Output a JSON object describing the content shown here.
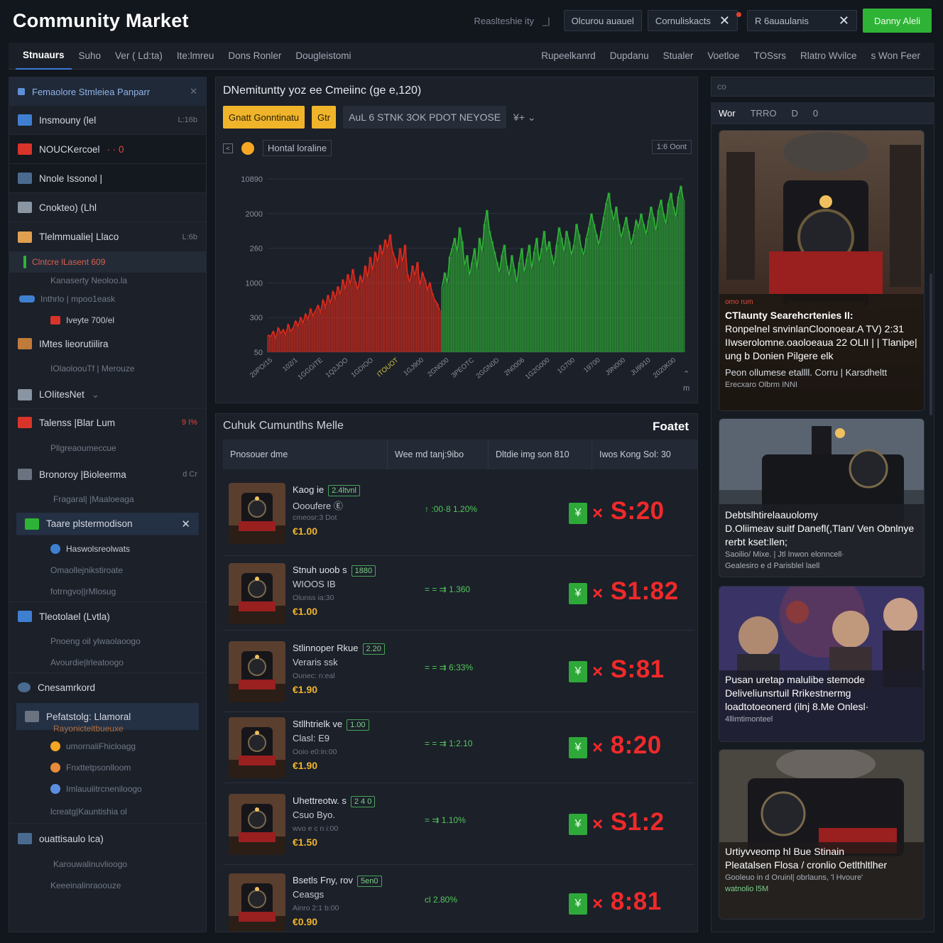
{
  "app": {
    "title": "Community Market"
  },
  "top": {
    "search_hint": "Reaslteshie ity",
    "chip1": "Olcurou auauel",
    "chip2": "Cornuliskacts",
    "chip3": "R 6auaulanis",
    "close_icon": "close-icon",
    "button": "Danny Aleli"
  },
  "nav": {
    "left": [
      "Stnuaurs",
      "Suho",
      "Ver ( Ld:ta)",
      "Ite:lmreu",
      "Dons Ronler",
      "Dougleistomi"
    ],
    "right": [
      "Rupeelkanrd",
      "Dupdanu",
      "Stualer",
      "Voetloe",
      "TOSsrs",
      "Rlatro Wvilce",
      "s Won Feer"
    ]
  },
  "sidebar": {
    "header": "Femaolore Stmleiea  Panparr",
    "items": [
      {
        "label": "Insmouny (lel",
        "meta": "L:16b",
        "style": "normal",
        "color": "#3f7fd0"
      },
      {
        "label": "NOUCKercoel",
        "meta": "· · 0",
        "style": "dark",
        "color": "#d9342a"
      },
      {
        "label": "Nnole Issonol |",
        "meta": "",
        "style": "dark",
        "color": "#4a6b8f"
      },
      {
        "label": "Cnokteo) (Lhl",
        "meta": "",
        "style": "normal",
        "color": "#8a95a3"
      },
      {
        "label": "Tlelmmualie| Llaco",
        "meta": "L:6b",
        "style": "normal",
        "color": "#e0a050"
      }
    ],
    "sub_hl": "Clntcre lLasent 609",
    "sub_a": "Kanaserty Neoloo.la",
    "sub_b": "Inthrlo | mpoo1eask",
    "sub_c": "Iveyte 700/el",
    "group2": [
      {
        "label": "IMtes lieorutiilira",
        "meta": "",
        "color": "#c07a3a",
        "sub": "IOlaoloouTf | Merouze"
      },
      {
        "label": "LOIitesNet",
        "meta": "",
        "color": "#8a95a3",
        "sub": ""
      },
      {
        "label": "Talenss  |Blar Lum",
        "meta": "9 I%",
        "color": "#d9342a",
        "sub": "Pllgreaoumeccue"
      },
      {
        "label": "Bronoroy |Bioleerma",
        "meta": "d Cr",
        "color": "#6b7380",
        "sub": "Fragaral| |Maaloeaga"
      }
    ],
    "selected": "Taare plstermodison",
    "selected_subs": [
      "Haswolsreolwats",
      "Omaollejnikstiroate",
      "fotrngvo||rMlosug"
    ],
    "group3": [
      {
        "label": "Tleotolael  (Lvtla)",
        "sub": "Pnoeng oil ylwaolaoogo",
        "sub2": "Avourdie|lrleatoogo",
        "color": "#3f7fd0"
      },
      {
        "label": "Cnesamrkord",
        "sub": "",
        "sub2": "",
        "color": "#4a6b8f"
      }
    ],
    "selected2": "Pefatstolg: Llamoral",
    "selected2_sub": "Rayonicteitbueuxe",
    "selected2_subs": [
      "umornaliFhicloagg",
      "Fnxttetpsonlloom",
      "Imlauuiitrcneniloogo",
      "lcreatg|Kauntishia ol"
    ],
    "last": "ouattisaulo lca)",
    "last_subs": [
      "Karouwalinuvlioogo",
      "Keeeinalinraoouze"
    ]
  },
  "chart": {
    "title": "DNemituntty yoz ee Cmeiinc (ge e,120)",
    "btn_primary": "Gnatt Gonntinatu",
    "btn_secondary": "Gtr",
    "tool_label": "AuL  6 STNK 3OK  PDOT NEYOSE",
    "tool_extra": "¥+ ⌄",
    "range_label": "Hontal loraline",
    "corner": "1:6 Oont",
    "corner_x": "m",
    "arrow": "⌃",
    "chart_data": {
      "type": "area",
      "y_ticks": [
        "10890",
        "2000",
        "260",
        "1000",
        "300",
        "50"
      ],
      "x_ticks": [
        "20PO/15",
        "102/1",
        "1GGGITE",
        "1Q2JOO",
        "1GDIOO",
        "ITOUOT",
        "1GJ900",
        "2GN000",
        "3PEOTC",
        "2GGN0D",
        "2N0006",
        "1G2G000",
        "1G700",
        "19700",
        "J9N000",
        "JU9910",
        "2020K00"
      ],
      "ylim": [
        0,
        100
      ],
      "red_values": [
        10,
        9,
        12,
        8,
        14,
        11,
        13,
        10,
        16,
        12,
        14,
        18,
        15,
        20,
        17,
        22,
        19,
        25,
        21,
        24,
        27,
        23,
        30,
        26,
        33,
        28,
        35,
        31,
        38,
        33,
        42,
        36,
        45,
        39,
        48,
        41,
        36,
        44,
        40,
        50,
        43,
        55,
        47,
        58,
        52,
        62,
        56,
        65,
        60,
        68,
        58,
        54,
        48,
        60,
        52,
        62,
        45,
        40,
        50,
        44,
        52,
        38,
        46,
        42,
        36,
        40,
        34,
        30,
        28,
        24
      ],
      "green_values": [
        38,
        46,
        40,
        55,
        60,
        66,
        58,
        72,
        64,
        50,
        56,
        44,
        52,
        60,
        48,
        66,
        58,
        74,
        82,
        70,
        64,
        58,
        52,
        46,
        56,
        62,
        50,
        44,
        56,
        48,
        40,
        52,
        60,
        46,
        54,
        62,
        48,
        58,
        66,
        52,
        60,
        70,
        58,
        64,
        56,
        50,
        62,
        72,
        66,
        58,
        70,
        64,
        56,
        62,
        74,
        68,
        60,
        56,
        66,
        72,
        80,
        74,
        68,
        62,
        70,
        78,
        86,
        92,
        82,
        76,
        84,
        74,
        66,
        72,
        78,
        70,
        62,
        68,
        76,
        72,
        80,
        74,
        68,
        76,
        84,
        78,
        70,
        82,
        88,
        80,
        74,
        86,
        92,
        84,
        78,
        90,
        96,
        88
      ],
      "colors": {
        "down": "#e02a1c",
        "up": "#2fb336"
      }
    }
  },
  "listing": {
    "title": "Cuhuk Cumuntlhs Melle",
    "filter": "Foatet",
    "columns": [
      "Pnosouer dme",
      "Wee md tanj:9ibo",
      "Dltdie img son 810",
      "Iwos Kong Sol: 30"
    ],
    "rows": [
      {
        "name": "Kaog ie",
        "badge": "2.4ltvnl",
        "sub": "Oooufere Ⓔ",
        "meta": "cmeosr:3 Dot",
        "price": "€1.00",
        "change": "↑ :00·8 1.20%",
        "big": "S:20"
      },
      {
        "name": "Stnuh uoob  s",
        "badge": "1880",
        "sub": "WIOOS IB",
        "meta": "Olunss ia:30",
        "price": "€1.00",
        "change": "= = ⇉ 1.360",
        "big": "S1:82"
      },
      {
        "name": "Stlinnoper Rkue",
        "badge": "2.20",
        "sub": "Veraris ssk",
        "meta": "Ounec: n:eal",
        "price": "€1.90",
        "change": "= = ⇉ 6:33%",
        "big": "S:81"
      },
      {
        "name": "Stllhtrielk  ve",
        "badge": "1.00",
        "sub": "Clasl: E9",
        "meta": "Ooio e0:in:00",
        "price": "€1.90",
        "change": "= = ⇉ 1:2.10",
        "big": "8:20"
      },
      {
        "name": "Uhettreotw.  s",
        "badge": "2 4 0",
        "sub": "Csuo Byo.",
        "meta": "wvo e c n i:00",
        "price": "€1.50",
        "change": "= ⇉ 1.10%",
        "big": "S1:2"
      },
      {
        "name": "Bsetls Fny, rov",
        "badge": "5en0",
        "sub": "Ceasgs",
        "meta": "Ainro 2:1 b:00",
        "price": "€0.90",
        "change": "cl 2.80%",
        "big": "8:81"
      }
    ],
    "buy_symbol": "¥",
    "multiply": "×"
  },
  "right": {
    "search": "co",
    "tabs": [
      "Wor",
      "TRRO",
      "D",
      "0"
    ],
    "cards": [
      {
        "tag": "omo rum",
        "title": "CTlaunty Searehcrtenies II:",
        "body": "Ronpelnel snvinlanCloonoear.A TV) 2:31 IIwserolomne.oaoloeaua 22 OLII | | Tlanipe| ung b Donien Pilgere elk",
        "small": "Peon ollumese etallll. Corru | Karsdheltt",
        "foot": "Erecxaro Olbrm INNI"
      },
      {
        "tag": "",
        "title": "Debtslhtirelaauolomy",
        "body": "D.Oliimeav suitf Danefl(,Tlan/ Ven Obnlnye rerbt kset:llen;",
        "small": "Saoilio/ Mixe. | Jtl Inwon elonncell·",
        "foot": "Gealesiro e d Parisblel laell"
      },
      {
        "tag": "",
        "title": "Pusan uretap malulibe stemode",
        "body": "Deliveliunsrtuil Rrikestnermg loadtotoeonerd (ilnj 8.Me Onlesl·",
        "small": "",
        "foot": "4llimtimonteel"
      },
      {
        "tag": "",
        "title": "Urtiyvveomp hl Bue Stinain",
        "body": "Pleatalsen Flosa / cronlio Oetlthltlher",
        "small": "Gooleuo in d Oruinl| obrlauns, 'l Hvoure'",
        "foot": "watnolio  l5M"
      }
    ]
  }
}
